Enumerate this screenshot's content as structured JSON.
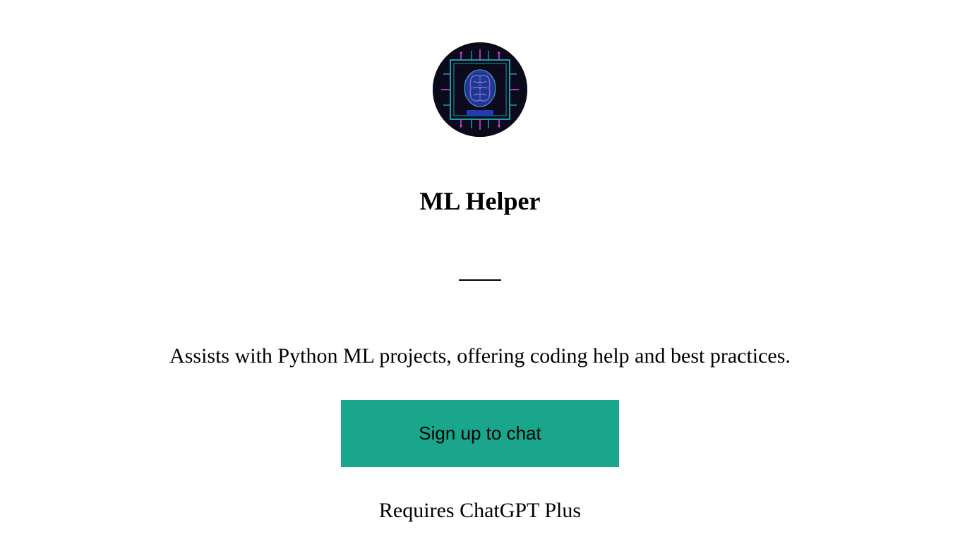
{
  "title": "ML Helper",
  "description": "Assists with Python ML projects, offering coding help and best practices.",
  "signup_label": "Sign up to chat",
  "requirement": "Requires ChatGPT Plus"
}
